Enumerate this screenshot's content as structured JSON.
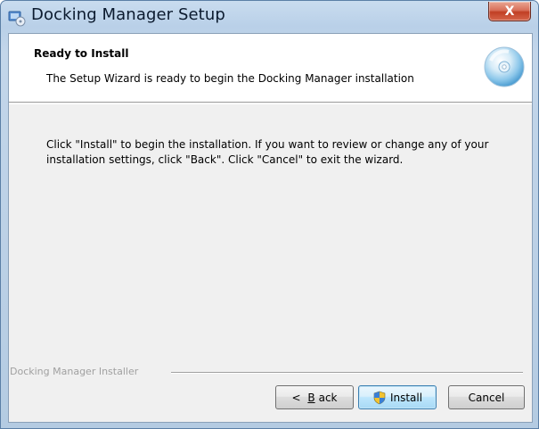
{
  "window": {
    "title": "Docking Manager Setup",
    "close_glyph": "X",
    "title_icon": "installer-icon"
  },
  "header": {
    "title": "Ready to Install",
    "subtitle": "The Setup Wizard is ready to begin the Docking Manager installation",
    "icon": "cd-disc-icon"
  },
  "body": {
    "line1": "Click \"Install\" to begin the installation.  If you want to review or change any of your",
    "line2": "installation settings, click \"Back\".  Click \"Cancel\" to exit the wizard."
  },
  "footer": {
    "group_label": "Docking Manager Installer"
  },
  "buttons": {
    "back_prefix": "< ",
    "back_accel": "B",
    "back_rest": "ack",
    "install_label": "Install",
    "install_icon": "uac-shield-icon",
    "cancel_label": "Cancel"
  },
  "colors": {
    "title_bar": "#b9d0e8",
    "close_button": "#c13f24",
    "client_background": "#f0f0f0",
    "header_background": "#ffffff",
    "default_button_border": "#3c7fb1"
  }
}
